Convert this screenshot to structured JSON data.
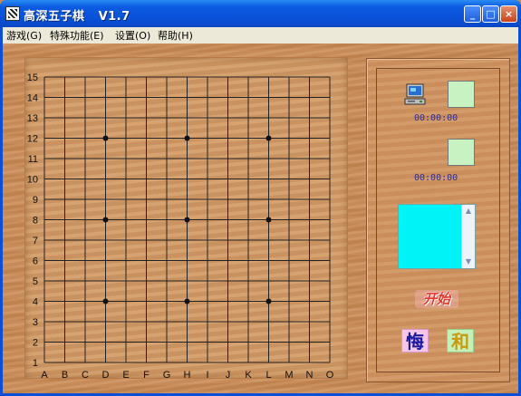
{
  "window": {
    "title": "高深五子棋   V1.7",
    "controls": {
      "minimize": "_",
      "maximize": "□",
      "close": "×"
    }
  },
  "menu": {
    "items": [
      "游戏(G)",
      "特殊功能(E)",
      "设置(O)",
      "帮助(H)"
    ]
  },
  "board": {
    "size": 15,
    "columns": [
      "A",
      "B",
      "C",
      "D",
      "E",
      "F",
      "G",
      "H",
      "I",
      "J",
      "K",
      "L",
      "M",
      "N",
      "O"
    ],
    "rows": [
      "15",
      "14",
      "13",
      "12",
      "11",
      "10",
      "9",
      "8",
      "7",
      "6",
      "5",
      "4",
      "3",
      "2",
      "1"
    ],
    "star_points": [
      "D12",
      "H12",
      "L12",
      "D8",
      "H8",
      "L8",
      "D4",
      "H4",
      "L4"
    ],
    "stones": []
  },
  "side_panel": {
    "player1": {
      "icon": "computer-icon",
      "timer": "00:00:00",
      "color": "#c7f2c2"
    },
    "player2": {
      "timer": "00:00:00",
      "color": "#c7f2c2"
    },
    "move_list": {
      "items": [],
      "background": "#00f3f7"
    },
    "start_label": "开始",
    "undo_label": "悔",
    "draw_label": "和"
  }
}
